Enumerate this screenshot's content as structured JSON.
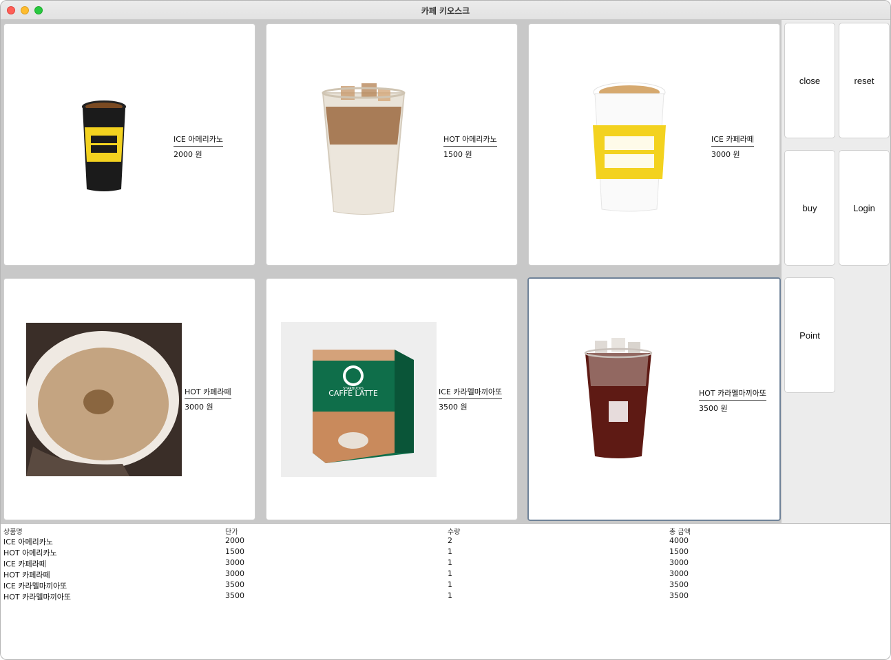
{
  "window": {
    "title": "카페 키오스크"
  },
  "menu": [
    {
      "name": "ICE 아메리카노",
      "price": "2000 원",
      "image": "mega-coffee-hot-cup"
    },
    {
      "name": "HOT 아메리카노",
      "price": "1500 원",
      "image": "iced-latte-cup"
    },
    {
      "name": "ICE 카페라떼",
      "price": "3000 원",
      "image": "mega-coffee-latte-cup"
    },
    {
      "name": "HOT 카페라떼",
      "price": "3000 원",
      "image": "latte-foam-photo"
    },
    {
      "name": "ICE 카라멜마끼아또",
      "price": "3500 원",
      "image": "starbucks-caffe-latte-box"
    },
    {
      "name": "HOT 카라멜마끼아또",
      "price": "3500 원",
      "image": "iced-americano-cup"
    }
  ],
  "buttons": {
    "close": "close",
    "reset": "reset",
    "buy": "buy",
    "login": "Login",
    "point": "Point"
  },
  "box_text": {
    "brand": "STARBUCKS",
    "product": "CAFFÈ LATTE"
  },
  "order_table": {
    "headers": [
      "상품명",
      "단가",
      "수량",
      "총 금액"
    ],
    "rows": [
      [
        "ICE 아메리카노",
        "2000",
        "2",
        "4000"
      ],
      [
        "HOT 아메리카노",
        "1500",
        "1",
        "1500"
      ],
      [
        "ICE 카페라떼",
        "3000",
        "1",
        "3000"
      ],
      [
        "HOT 카페라떼",
        "3000",
        "1",
        "3000"
      ],
      [
        "ICE 카라멜마끼아또",
        "3500",
        "1",
        "3500"
      ],
      [
        "HOT 카라멜마끼아또",
        "3500",
        "1",
        "3500"
      ]
    ]
  },
  "colors": {
    "selected_border": "#6f8298",
    "brand_yellow": "#f3d21f"
  }
}
